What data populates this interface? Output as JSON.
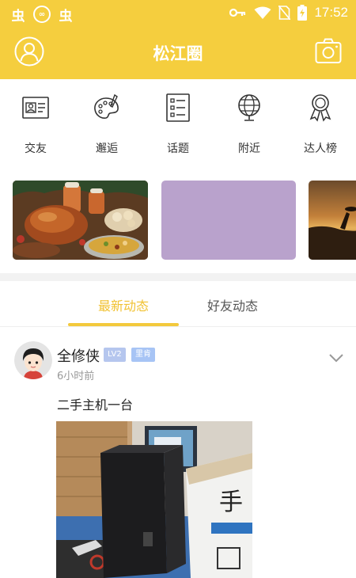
{
  "status_bar": {
    "app_icons": [
      "虫",
      "∞",
      "虫"
    ],
    "time": "17:52"
  },
  "header": {
    "title": "松江圈"
  },
  "categories": [
    {
      "label": "交友",
      "icon": "id-card-icon"
    },
    {
      "label": "邂逅",
      "icon": "palette-icon"
    },
    {
      "label": "话题",
      "icon": "list-icon"
    },
    {
      "label": "附近",
      "icon": "globe-icon"
    },
    {
      "label": "达人榜",
      "icon": "medal-icon"
    }
  ],
  "tabs": [
    {
      "label": "最新动态",
      "active": true
    },
    {
      "label": "好友动态",
      "active": false
    }
  ],
  "post": {
    "author": "全修侠",
    "level_badge": "LV2",
    "tag_badge": "里肯",
    "time": "6小时前",
    "text": "二手主机一台"
  },
  "colors": {
    "brand_yellow": "#f5ce3e",
    "tab_active": "#f1c232",
    "banner_purple": "#b9a2cc"
  }
}
